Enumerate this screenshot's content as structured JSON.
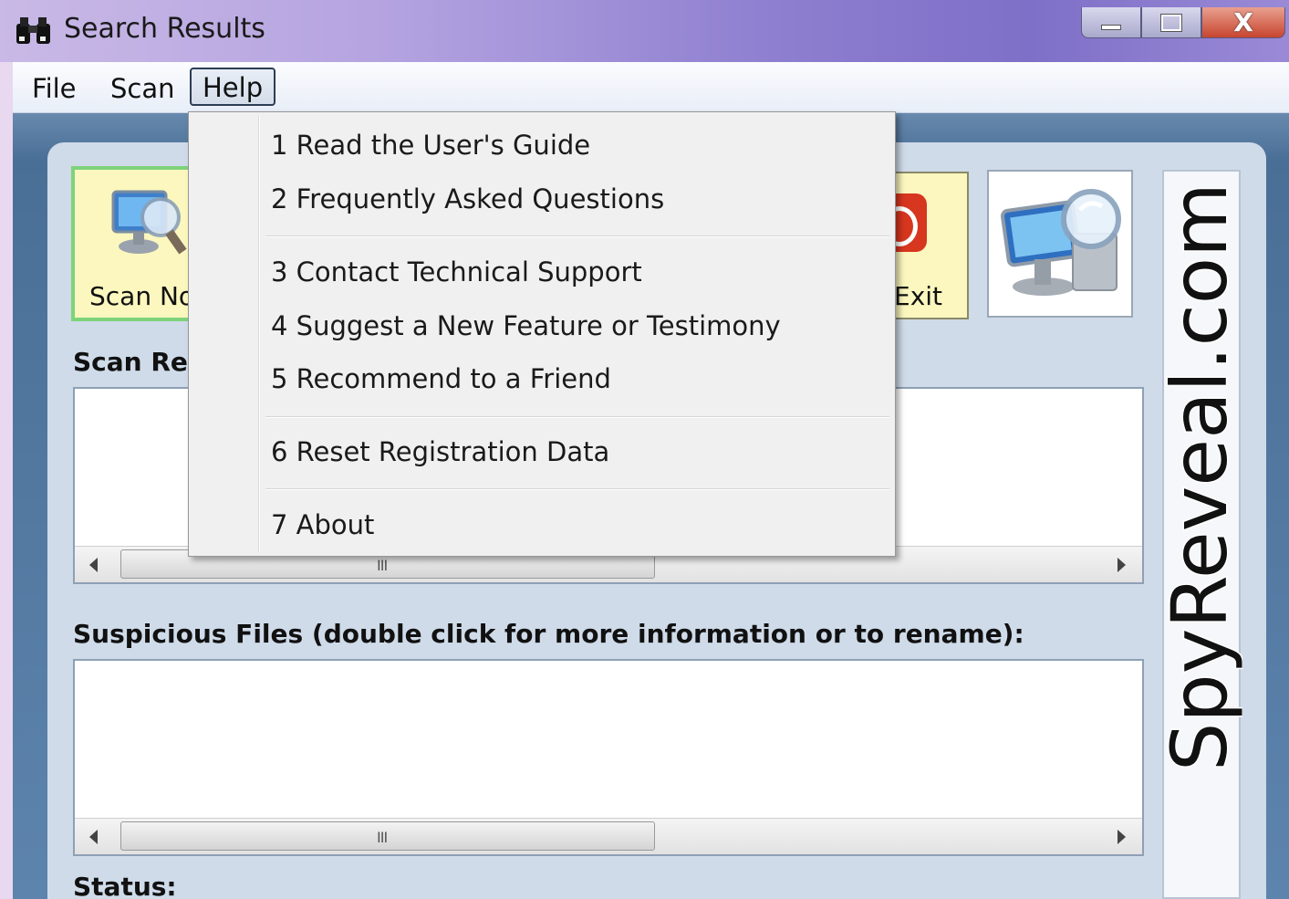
{
  "window": {
    "title": "Search Results",
    "controls": {
      "minimize": "minimize",
      "maximize": "maximize",
      "close": "X"
    }
  },
  "menubar": {
    "items": [
      {
        "label": "File"
      },
      {
        "label": "Scan"
      },
      {
        "label": "Help"
      }
    ]
  },
  "help_menu": {
    "items": [
      {
        "label": "1 Read the User's Guide"
      },
      {
        "label": "2 Frequently Asked Questions"
      },
      {
        "label": "3 Contact Technical Support"
      },
      {
        "label": "4 Suggest a New Feature or Testimony"
      },
      {
        "label": "5 Recommend to a Friend"
      },
      {
        "label": "6 Reset Registration Data"
      },
      {
        "label": "7 About"
      }
    ]
  },
  "toolbar": {
    "scan_now_label": "Scan Now",
    "exit_label": "Exit"
  },
  "brand": {
    "text": "SpyReveal.com"
  },
  "sections": {
    "scan_results_label": "Scan Results:",
    "suspicious_files_label": "Suspicious Files (double click for more information or to rename):",
    "status_label": "Status:"
  },
  "scrollbar": {
    "grip": "III"
  },
  "colors": {
    "titlebar": "#8e7fd0",
    "panel": "#cfdbe9",
    "button_face": "#fbf7be",
    "active_button_border": "#7ed37a"
  }
}
